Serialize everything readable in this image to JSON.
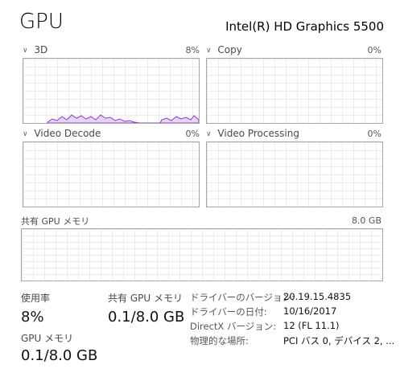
{
  "header": {
    "title": "GPU",
    "adapter_name": "Intel(R) HD Graphics 5500"
  },
  "graphs": [
    {
      "label": "3D",
      "percent": "8%"
    },
    {
      "label": "Copy",
      "percent": "0%"
    },
    {
      "label": "Video Decode",
      "percent": "0%"
    },
    {
      "label": "Video Processing",
      "percent": "0%"
    }
  ],
  "shared_memory_graph": {
    "label": "共有 GPU メモリ",
    "max": "8.0 GB"
  },
  "stats": {
    "utilization_label": "使用率",
    "utilization_value": "8%",
    "shared_mem_label": "共有 GPU メモリ",
    "shared_mem_value": "0.1/8.0 GB",
    "gpu_mem_label": "GPU メモリ",
    "gpu_mem_value": "0.1/8.0 GB"
  },
  "info": [
    {
      "key": "ドライバーのバージョン:",
      "value": "20.19.15.4835"
    },
    {
      "key": "ドライバーの日付:",
      "value": "10/16/2017"
    },
    {
      "key": "DirectX バージョン:",
      "value": "12 (FL 11.1)"
    },
    {
      "key": "物理的な場所:",
      "value": "PCI バス 0, デバイス 2, ..."
    }
  ],
  "colors": {
    "graph_line": "#8b3fbf",
    "graph_fill": "#e7d3f5",
    "graph_border": "#a6a6a6"
  }
}
